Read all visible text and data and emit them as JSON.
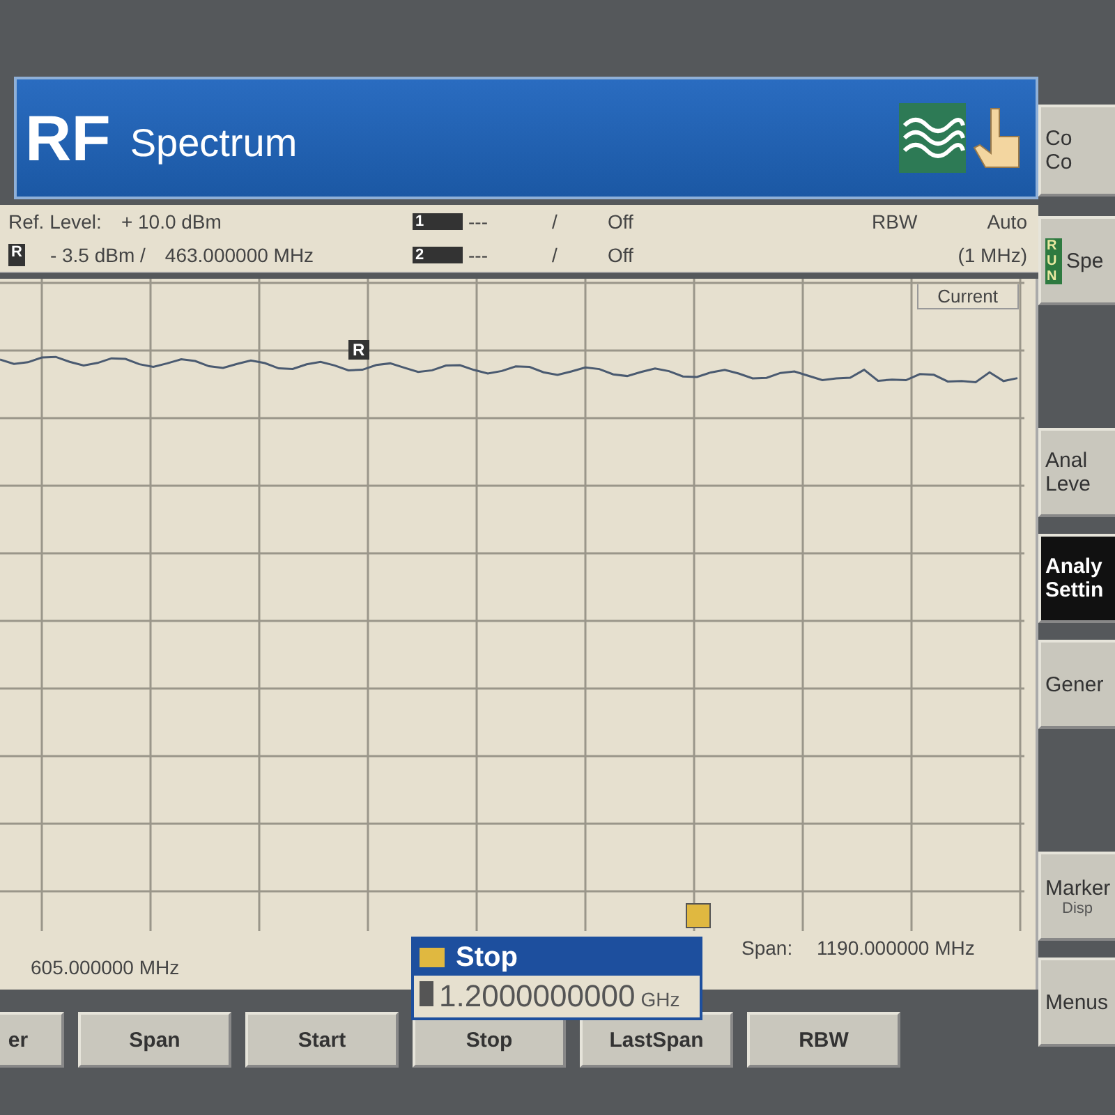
{
  "header": {
    "logo": "RF",
    "title": "Spectrum",
    "side_button": [
      "Co",
      "Co"
    ]
  },
  "info": {
    "ref_level_label": "Ref. Level:",
    "ref_level_value": "+ 10.0  dBm",
    "ref_marker": {
      "symbol": "R",
      "level": "- 3.5  dBm /",
      "frequency": "463.000000  MHz"
    },
    "markers": [
      {
        "symbol": "1",
        "value": "---",
        "separator": "/",
        "state": "Off"
      },
      {
        "symbol": "2",
        "value": "---",
        "separator": "/",
        "state": "Off"
      }
    ],
    "rbw": {
      "label": "RBW",
      "value": "Auto",
      "detail": "(1 MHz)"
    }
  },
  "plot": {
    "trace_label": "Current",
    "marker_symbol": "R",
    "start_frequency": "605.000000  MHz",
    "span_label": "Span:",
    "span_value": "1190.000000  MHz"
  },
  "popup": {
    "title": "Stop",
    "value": "1.2000000000",
    "unit": "GHz"
  },
  "side_keys": [
    {
      "kind": "run",
      "badge": "RUN",
      "lines": [
        "Spe"
      ],
      "selected": false
    },
    {
      "kind": "plain",
      "lines": [
        "Anal",
        "Leve"
      ],
      "selected": false
    },
    {
      "kind": "plain",
      "lines": [
        "Analy",
        "Settin"
      ],
      "selected": true
    },
    {
      "kind": "plain",
      "lines": [
        "Gener"
      ],
      "selected": false
    },
    {
      "kind": "sub",
      "lines": [
        "Marker"
      ],
      "sublabel": "Disp",
      "selected": false
    },
    {
      "kind": "plain",
      "lines": [
        "Menus"
      ],
      "selected": false
    }
  ],
  "soft_keys": [
    "er",
    "Span",
    "Start",
    "Stop",
    "LastSpan",
    "RBW"
  ]
}
